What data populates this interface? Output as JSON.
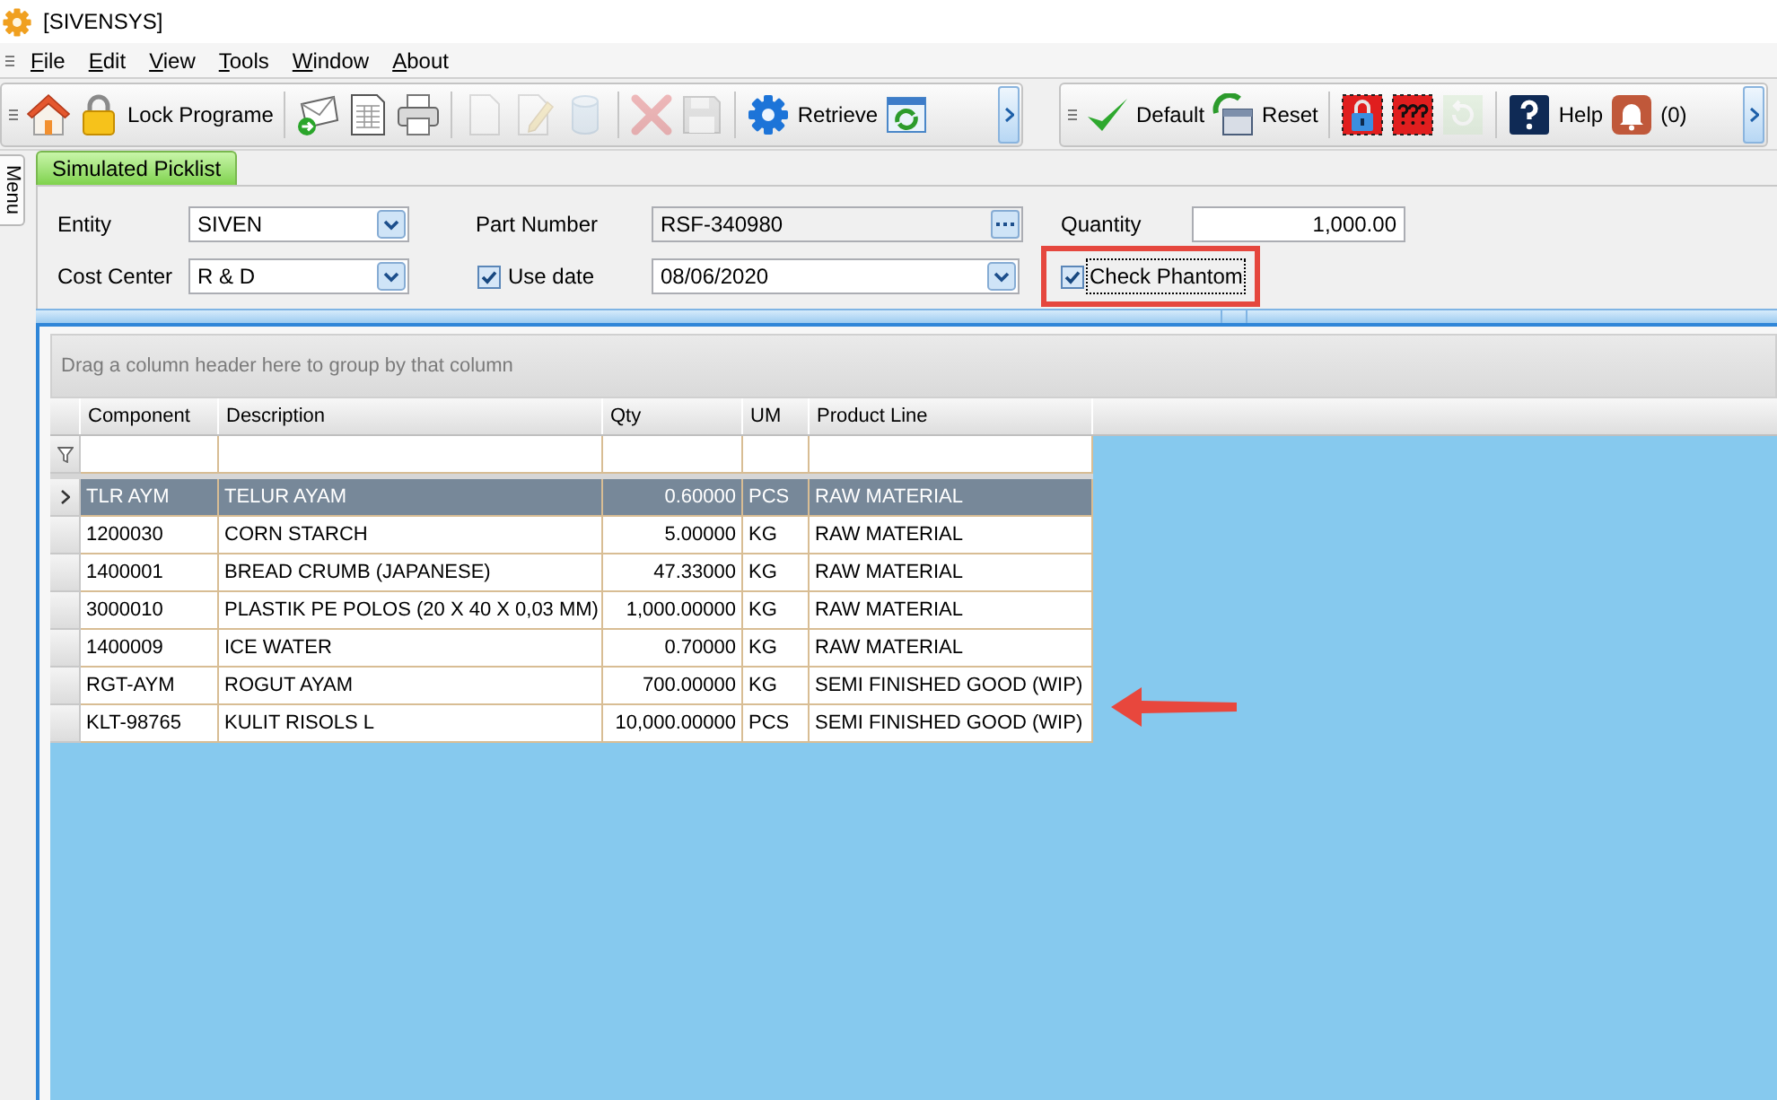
{
  "window": {
    "title": "[SIVENSYS]"
  },
  "menu": [
    {
      "label": "File"
    },
    {
      "label": "Edit"
    },
    {
      "label": "View"
    },
    {
      "label": "Tools"
    },
    {
      "label": "Window"
    },
    {
      "label": "About"
    }
  ],
  "toolbars": [
    {
      "groups": [
        [
          {
            "disabled": false
          },
          {
            "label": "Lock Programe",
            "disabled": false
          }
        ],
        [
          {
            "disabled": false
          },
          {
            "disabled": false
          },
          {
            "disabled": false
          }
        ],
        [
          {
            "disabled": true
          },
          {
            "disabled": true
          },
          {
            "disabled": true
          }
        ],
        [
          {
            "disabled": true
          },
          {
            "disabled": true
          }
        ],
        [
          {
            "label": "Retrieve",
            "disabled": false
          },
          {
            "disabled": false
          }
        ]
      ]
    },
    {
      "groups": [
        [
          {
            "label": "Default",
            "disabled": false
          },
          {
            "label": "Reset",
            "disabled": false
          }
        ],
        [
          {
            "disabled": false
          },
          {
            "disabled": false
          },
          {
            "disabled": true
          }
        ],
        [
          {
            "label": "Help",
            "disabled": false
          },
          {
            "label": "(0)",
            "disabled": false
          }
        ]
      ]
    }
  ],
  "side_tabs": [
    {
      "label": "Menu"
    }
  ],
  "tabs": [
    {
      "label": "Simulated Picklist",
      "selected": true
    }
  ],
  "form": {
    "entity": {
      "label": "Entity",
      "value": "SIVEN"
    },
    "cost_center": {
      "label": "Cost Center",
      "value": "R & D"
    },
    "part_number": {
      "label": "Part Number",
      "value": "RSF-340980",
      "read_only": true
    },
    "use_date": {
      "label": "Use date",
      "checked": true
    },
    "date": {
      "value": "08/06/2020"
    },
    "quantity": {
      "label": "Quantity",
      "value": "1,000.00"
    },
    "check_phantom": {
      "label": "Check Phantom",
      "checked": true,
      "focused": true,
      "highlighted": true
    }
  },
  "grid": {
    "group_panel_hint": "Drag a column header here to group by that column",
    "columns": [
      "Component",
      "Description",
      "Qty",
      "UM",
      "Product Line"
    ],
    "rows": [
      {
        "cells": [
          "TLR AYM",
          "TELUR AYAM",
          "0.60000",
          "PCS",
          "RAW MATERIAL"
        ],
        "selected": true
      },
      {
        "cells": [
          "1200030",
          "CORN STARCH",
          "5.00000",
          "KG",
          "RAW MATERIAL"
        ],
        "selected": false
      },
      {
        "cells": [
          "1400001",
          "BREAD CRUMB (JAPANESE)",
          "47.33000",
          "KG",
          "RAW MATERIAL"
        ],
        "selected": false
      },
      {
        "cells": [
          "3000010",
          "PLASTIK PE POLOS (20 X 40 X 0,03 MM)",
          "1,000.00000",
          "KG",
          "RAW MATERIAL"
        ],
        "selected": false
      },
      {
        "cells": [
          "1400009",
          "ICE WATER",
          "0.70000",
          "KG",
          "RAW MATERIAL"
        ],
        "selected": false
      },
      {
        "cells": [
          "RGT-AYM",
          "ROGUT AYAM",
          "700.00000",
          "KG",
          "SEMI FINISHED GOOD (WIP)"
        ],
        "selected": false
      },
      {
        "cells": [
          "KLT-98765",
          "KULIT RISOLS L",
          "10,000.00000",
          "PCS",
          "SEMI FINISHED GOOD (WIP)"
        ],
        "selected": false
      }
    ],
    "arrow_marker": true
  }
}
